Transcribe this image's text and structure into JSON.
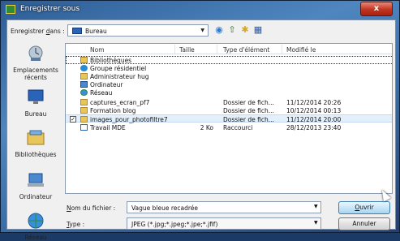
{
  "window": {
    "title": "Enregistrer sous",
    "close_label": "x"
  },
  "save_in": {
    "label_prefix": "Enregistrer ",
    "label_u": "d",
    "label_suffix": "ans :",
    "location": "Bureau"
  },
  "places": [
    {
      "label": "Emplacements récents",
      "icon": "recent-places-icon"
    },
    {
      "label": "Bureau",
      "icon": "desktop-icon"
    },
    {
      "label": "Bibliothèques",
      "icon": "libraries-icon"
    },
    {
      "label": "Ordinateur",
      "icon": "computer-icon"
    },
    {
      "label": "Réseau",
      "icon": "network-icon"
    }
  ],
  "columns": {
    "name": "Nom",
    "size": "Taille",
    "type": "Type d'élément",
    "modified": "Modifié le"
  },
  "files": [
    {
      "name": "Bibliothèques",
      "size": "",
      "type": "",
      "modified": "",
      "icon": "libraries-icon"
    },
    {
      "name": "Groupe résidentiel",
      "size": "",
      "type": "",
      "modified": "",
      "icon": "homegroup-icon"
    },
    {
      "name": "Administrateur hug",
      "size": "",
      "type": "",
      "modified": "",
      "icon": "user-folder-icon"
    },
    {
      "name": "Ordinateur",
      "size": "",
      "type": "",
      "modified": "",
      "icon": "computer-icon"
    },
    {
      "name": "Réseau",
      "size": "",
      "type": "",
      "modified": "",
      "icon": "network-icon"
    },
    {
      "name": "captures_ecran_pf7",
      "size": "",
      "type": "Dossier de fich...",
      "modified": "11/12/2014 20:26",
      "icon": "folder-icon"
    },
    {
      "name": "Formation blog",
      "size": "",
      "type": "Dossier de fich...",
      "modified": "10/12/2014 00:13",
      "icon": "folder-icon"
    },
    {
      "name": "images_pour_photofiltre7",
      "size": "",
      "type": "Dossier de fich...",
      "modified": "11/12/2014 20:00",
      "icon": "folder-icon",
      "selected": true
    },
    {
      "name": "Travail MDE",
      "size": "2 Ko",
      "type": "Raccourci",
      "modified": "28/12/2013 23:40",
      "icon": "shortcut-icon"
    }
  ],
  "filename": {
    "label_u": "N",
    "label_rest": "om du fichier :",
    "value": "Vague bleue recadrée"
  },
  "filetype": {
    "label_u": "T",
    "label_rest": "ype :",
    "value": "JPEG (*.jpg;*.jpeg;*.jpe;*.jfif)"
  },
  "buttons": {
    "open_u": "O",
    "open_rest": "uvrir",
    "cancel": "Annuler"
  }
}
